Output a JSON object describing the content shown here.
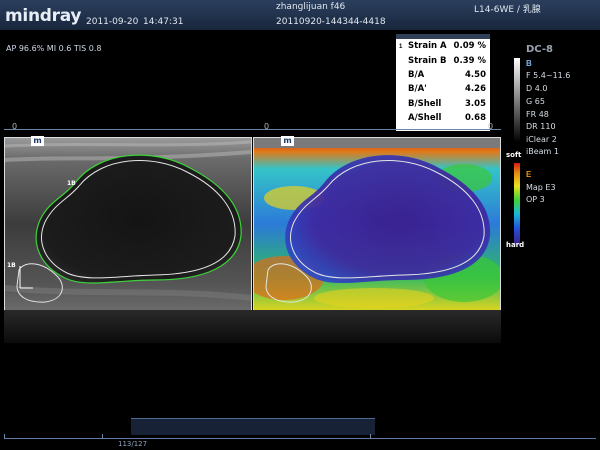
{
  "header": {
    "brand": "mindray",
    "date": "2011-09-20",
    "time": "14:47:31",
    "patient": "zhanglijuan f46",
    "exam_id": "20110920-144344-4418",
    "probe": "L14-6WE / 乳腺"
  },
  "params": "AP 96.6%  MI 0.6  TIS 0.8",
  "strain_table": {
    "index": "1",
    "rows": [
      {
        "label": "Strain A",
        "value": "0.09 %"
      },
      {
        "label": "Strain B",
        "value": "0.39 %"
      },
      {
        "label": "B/A",
        "value": "4.50"
      },
      {
        "label": "B/A'",
        "value": "4.26"
      },
      {
        "label": "B/Shell",
        "value": "3.05"
      },
      {
        "label": "A/Shell",
        "value": "0.68"
      }
    ]
  },
  "right_panel": {
    "title": "DC-8",
    "b_section": {
      "letter": "B",
      "lines": [
        "F 5.4~11.6",
        "D 4.0",
        "G 65",
        "FR 48",
        "DR 110",
        "iClear 2",
        "iBeam 1"
      ]
    },
    "e_section": {
      "letter": "E",
      "lines": [
        "Map E3",
        "OP 3"
      ]
    },
    "soft_label": "soft",
    "hard_label": "hard"
  },
  "images": {
    "left_badge": "m",
    "right_badge": "m",
    "zero_left": "0",
    "zero_right": "0",
    "zero_far": "0",
    "roi_label_a": "1B",
    "roi_label_b": "1B"
  },
  "cine": {
    "frame": "113/127"
  },
  "colors": {
    "header_bg": "#1f3150",
    "roi_outline": "#3ed23a"
  }
}
